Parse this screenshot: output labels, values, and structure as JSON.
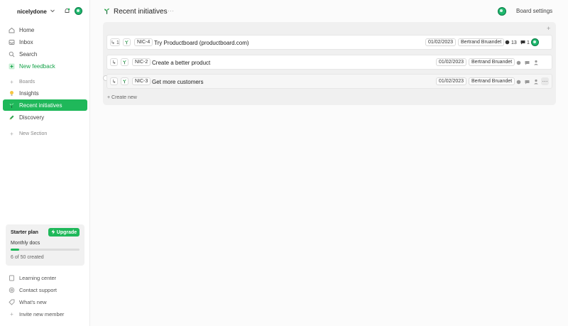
{
  "workspace": {
    "name": "nicelydone"
  },
  "nav": {
    "home": "Home",
    "inbox": "Inbox",
    "search": "Search",
    "new_feedback": "New feedback",
    "boards": "Boards",
    "insights": "Insights",
    "recent_initiatives": "Recent initiatives",
    "discovery": "Discovery",
    "new_section": "New Section"
  },
  "plan": {
    "title": "Starter plan",
    "upgrade": "Upgrade",
    "subtitle": "Monthly docs",
    "count_text": "6 of 50 created",
    "progress": 0.12
  },
  "bottom_nav": {
    "learning": "Learning center",
    "support": "Contact support",
    "whats_new": "What's new",
    "invite": "Invite new member"
  },
  "header": {
    "title": "Recent initiatives",
    "more": "···",
    "board_settings": "Board settings"
  },
  "rows": [
    {
      "sub": "↳ 1",
      "key": "NIC-4",
      "title": "Try Productboard (productboard.com)",
      "date": "01/02/2023",
      "owner": "Bertrand Bruandet",
      "insights": "13",
      "comments": "1"
    },
    {
      "sub": "↳",
      "key": "NIC-2",
      "title": "Create a better product",
      "date": "01/02/2023",
      "owner": "Bertrand Bruandet"
    },
    {
      "sub": "↳",
      "key": "NIC-3",
      "title": "Get more customers",
      "date": "01/02/2023",
      "owner": "Bertrand Bruandet",
      "more": "···"
    }
  ],
  "create_new": "+ Create new",
  "colors": {
    "accent": "#1fb85a",
    "brand_dark": "#0a7a45"
  }
}
